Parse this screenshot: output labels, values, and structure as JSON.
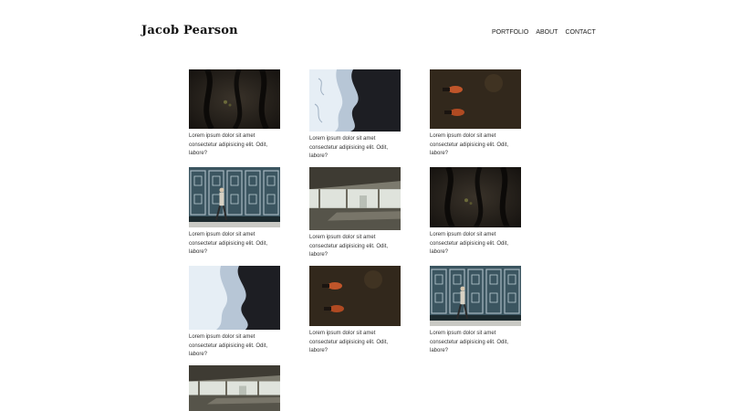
{
  "header": {
    "title": "Jacob Pearson",
    "nav": [
      {
        "label": "PORTFOLIO"
      },
      {
        "label": "ABOUT"
      },
      {
        "label": "CONTACT"
      }
    ]
  },
  "gallery": {
    "items": [
      {
        "image": "tree-bark",
        "caption": "Lorem ipsum dolor sit amet consectetur adipisicing elit. Odit, labore?"
      },
      {
        "image": "ocean-wave",
        "caption": "Lorem ipsum dolor sit amet consectetur adipisicing elit. Odit, labore?"
      },
      {
        "image": "feet-on-ground",
        "caption": "Lorem ipsum dolor sit amet consectetur adipisicing elit. Odit, labore?"
      },
      {
        "image": "man-walking-tiled-wall",
        "caption": "Lorem ipsum dolor sit amet consectetur adipisicing elit. Odit, labore?"
      },
      {
        "image": "empty-office-interior",
        "caption": "Lorem ipsum dolor sit amet consectetur adipisicing elit. Odit, labore?"
      },
      {
        "image": "tree-bark",
        "caption": "Lorem ipsum dolor sit amet consectetur adipisicing elit. Odit, labore?"
      },
      {
        "image": "ocean-wave",
        "caption": "Lorem ipsum dolor sit amet consectetur adipisicing elit. Odit, labore?"
      },
      {
        "image": "feet-on-ground",
        "caption": "Lorem ipsum dolor sit amet consectetur adipisicing elit. Odit, labore?"
      },
      {
        "image": "man-walking-tiled-wall",
        "caption": "Lorem ipsum dolor sit amet consectetur adipisicing elit. Odit, labore?"
      },
      {
        "image": "empty-office-interior",
        "caption": ""
      }
    ]
  },
  "colors": {
    "background": "#ffffff",
    "text": "#222222"
  }
}
